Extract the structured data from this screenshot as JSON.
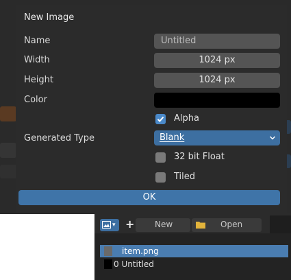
{
  "dialog": {
    "title": "New Image",
    "fields": {
      "name_label": "Name",
      "name_value": "Untitled",
      "width_label": "Width",
      "width_value": "1024 px",
      "height_label": "Height",
      "height_value": "1024 px",
      "color_label": "Color",
      "color_value": "#000000",
      "alpha_label": "Alpha",
      "alpha_checked": true,
      "generated_type_label": "Generated Type",
      "generated_type_value": "Blank",
      "float_label": "32 bit Float",
      "float_checked": false,
      "tiled_label": "Tiled",
      "tiled_checked": false
    },
    "ok_label": "OK"
  },
  "browser": {
    "new_label": "New",
    "open_label": "Open",
    "items": [
      {
        "label": "item.png",
        "selected": true
      },
      {
        "label": "0 Untitled",
        "selected": false
      }
    ]
  },
  "colors": {
    "accent": "#4a89c9",
    "button_blue": "#3f74a8",
    "dialog_bg": "#2b2b2b",
    "field_bg": "#545454"
  },
  "icons": [
    "checkmark-icon",
    "chevron-down-icon",
    "image-icon",
    "plus-icon",
    "folder-icon"
  ]
}
